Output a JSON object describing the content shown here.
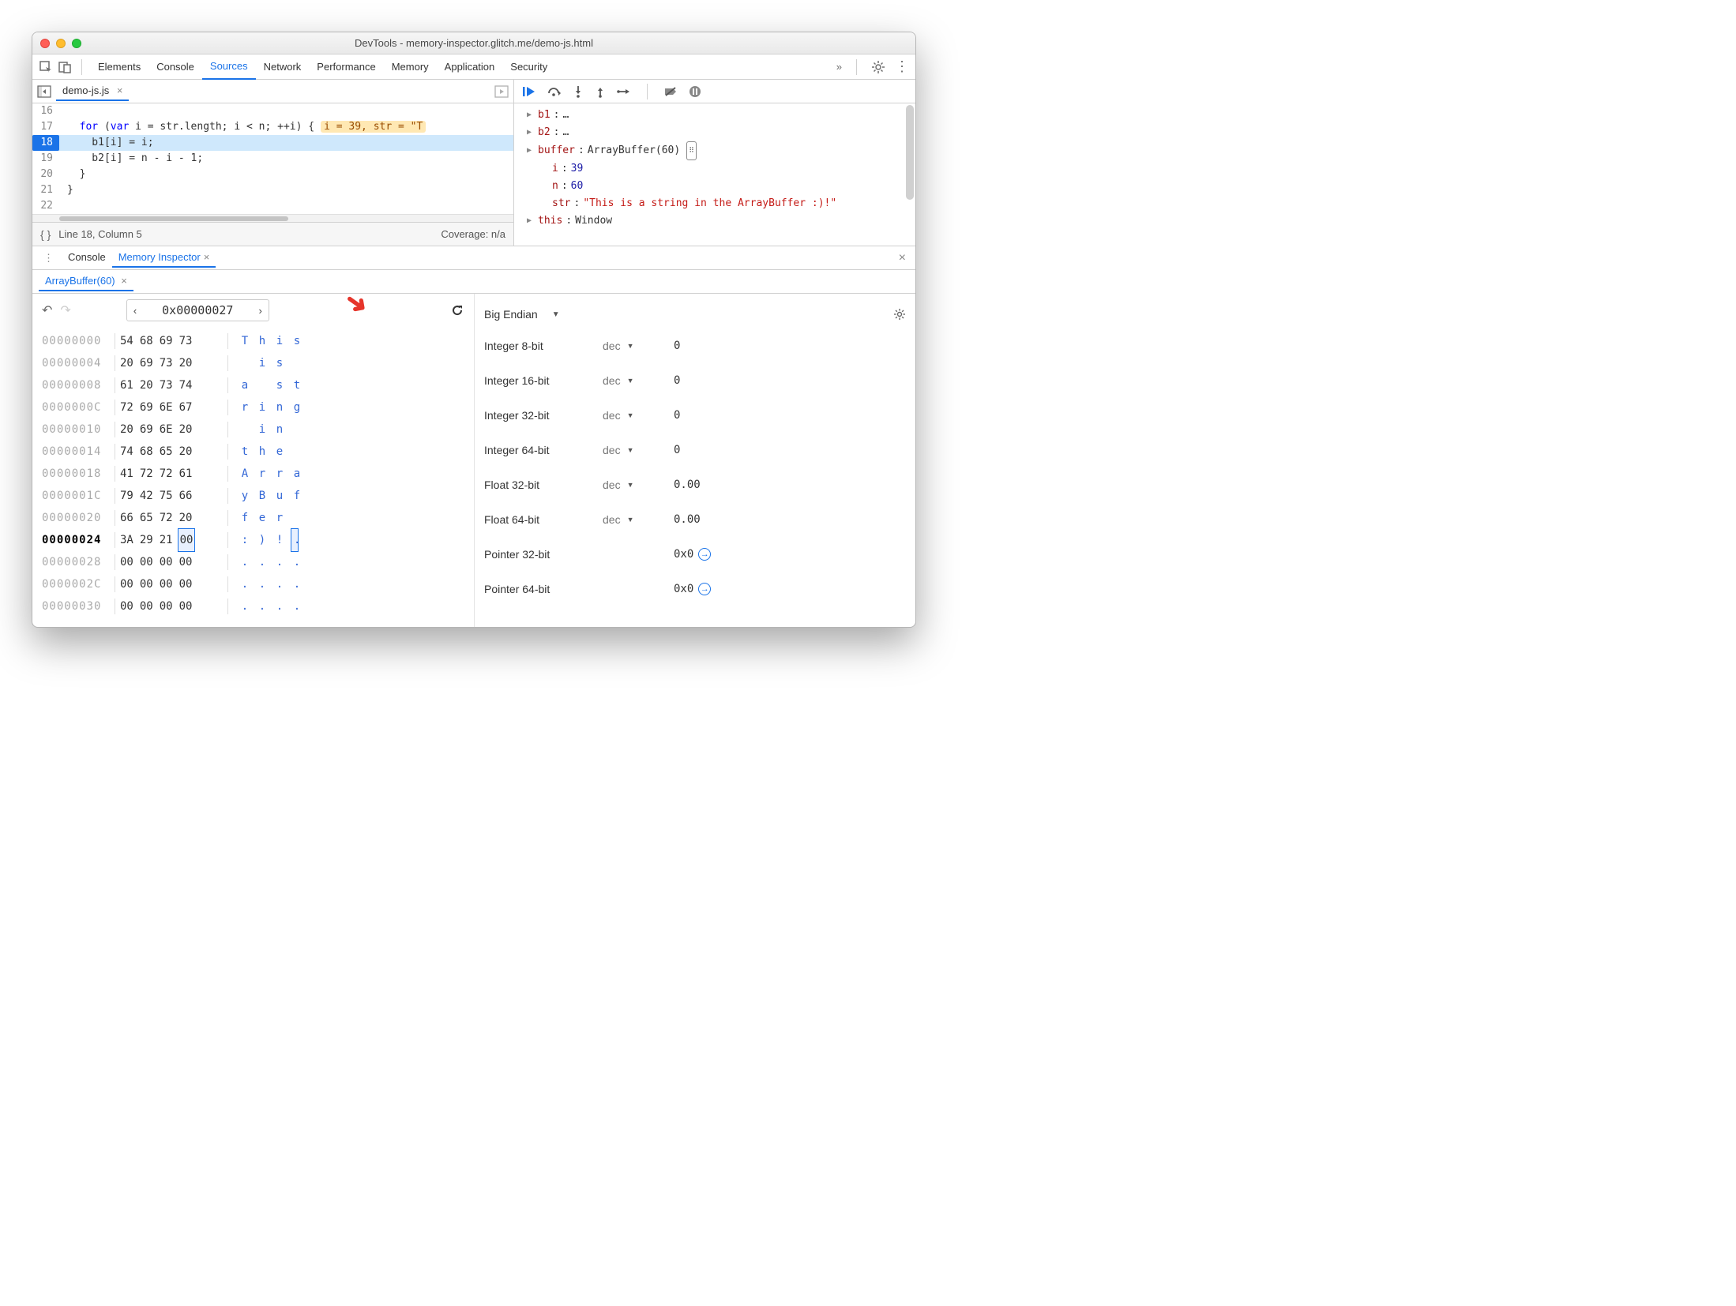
{
  "window": {
    "title": "DevTools - memory-inspector.glitch.me/demo-js.html"
  },
  "toolbar": {
    "tabs": [
      "Elements",
      "Console",
      "Sources",
      "Network",
      "Performance",
      "Memory",
      "Application",
      "Security"
    ],
    "activeTab": "Sources",
    "overflow": "»"
  },
  "sources": {
    "openFile": "demo-js.js",
    "lines": [
      {
        "n": "16",
        "text": ""
      },
      {
        "n": "17",
        "text": "  for (var i = str.length; i < n; ++i) {",
        "inline": "i = 39, str = \"T"
      },
      {
        "n": "18",
        "text": "    b1[i] = i;",
        "bp": true,
        "hl": true
      },
      {
        "n": "19",
        "text": "    b2[i] = n - i - 1;"
      },
      {
        "n": "20",
        "text": "  }"
      },
      {
        "n": "21",
        "text": "}"
      },
      {
        "n": "22",
        "text": ""
      }
    ],
    "status": {
      "pos": "Line 18, Column 5",
      "coverage": "Coverage: n/a"
    }
  },
  "scope": {
    "items": [
      {
        "name": "b1",
        "value": "…"
      },
      {
        "name": "b2",
        "value": "…"
      },
      {
        "name": "buffer",
        "value": "ArrayBuffer(60)",
        "mem": true
      },
      {
        "name": "i",
        "value": "39",
        "num": true,
        "indent": true
      },
      {
        "name": "n",
        "value": "60",
        "num": true,
        "indent": true
      },
      {
        "name": "str",
        "value": "\"This is a string in the ArrayBuffer :)!\"",
        "str": true,
        "indent": true
      },
      {
        "name": "this",
        "value": "Window"
      }
    ]
  },
  "drawer": {
    "tabs": [
      "Console",
      "Memory Inspector"
    ],
    "activeTab": "Memory Inspector",
    "bufferTab": "ArrayBuffer(60)"
  },
  "memoryInspector": {
    "address": "0x00000027",
    "rows": [
      {
        "addr": "00000000",
        "hex": [
          "54",
          "68",
          "69",
          "73"
        ],
        "asc": [
          "T",
          "h",
          "i",
          "s"
        ]
      },
      {
        "addr": "00000004",
        "hex": [
          "20",
          "69",
          "73",
          "20"
        ],
        "asc": [
          " ",
          "i",
          "s",
          " "
        ]
      },
      {
        "addr": "00000008",
        "hex": [
          "61",
          "20",
          "73",
          "74"
        ],
        "asc": [
          "a",
          " ",
          "s",
          "t"
        ]
      },
      {
        "addr": "0000000C",
        "hex": [
          "72",
          "69",
          "6E",
          "67"
        ],
        "asc": [
          "r",
          "i",
          "n",
          "g"
        ]
      },
      {
        "addr": "00000010",
        "hex": [
          "20",
          "69",
          "6E",
          "20"
        ],
        "asc": [
          " ",
          "i",
          "n",
          " "
        ]
      },
      {
        "addr": "00000014",
        "hex": [
          "74",
          "68",
          "65",
          "20"
        ],
        "asc": [
          "t",
          "h",
          "e",
          " "
        ]
      },
      {
        "addr": "00000018",
        "hex": [
          "41",
          "72",
          "72",
          "61"
        ],
        "asc": [
          "A",
          "r",
          "r",
          "a"
        ]
      },
      {
        "addr": "0000001C",
        "hex": [
          "79",
          "42",
          "75",
          "66"
        ],
        "asc": [
          "y",
          "B",
          "u",
          "f"
        ]
      },
      {
        "addr": "00000020",
        "hex": [
          "66",
          "65",
          "72",
          "20"
        ],
        "asc": [
          "f",
          "e",
          "r",
          " "
        ]
      },
      {
        "addr": "00000024",
        "hex": [
          "3A",
          "29",
          "21",
          "00"
        ],
        "asc": [
          ":",
          ")",
          "!",
          "."
        ],
        "bold": true,
        "selIdx": 3
      },
      {
        "addr": "00000028",
        "hex": [
          "00",
          "00",
          "00",
          "00"
        ],
        "asc": [
          ".",
          ".",
          ".",
          "."
        ]
      },
      {
        "addr": "0000002C",
        "hex": [
          "00",
          "00",
          "00",
          "00"
        ],
        "asc": [
          ".",
          ".",
          ".",
          "."
        ]
      },
      {
        "addr": "00000030",
        "hex": [
          "00",
          "00",
          "00",
          "00"
        ],
        "asc": [
          ".",
          ".",
          ".",
          "."
        ]
      }
    ],
    "endian": "Big Endian",
    "values": [
      {
        "type": "Integer 8-bit",
        "fmt": "dec",
        "val": "0"
      },
      {
        "type": "Integer 16-bit",
        "fmt": "dec",
        "val": "0"
      },
      {
        "type": "Integer 32-bit",
        "fmt": "dec",
        "val": "0"
      },
      {
        "type": "Integer 64-bit",
        "fmt": "dec",
        "val": "0"
      },
      {
        "type": "Float 32-bit",
        "fmt": "dec",
        "val": "0.00"
      },
      {
        "type": "Float 64-bit",
        "fmt": "dec",
        "val": "0.00"
      },
      {
        "type": "Pointer 32-bit",
        "fmt": "",
        "val": "0x0",
        "ptr": true
      },
      {
        "type": "Pointer 64-bit",
        "fmt": "",
        "val": "0x0",
        "ptr": true
      }
    ]
  }
}
